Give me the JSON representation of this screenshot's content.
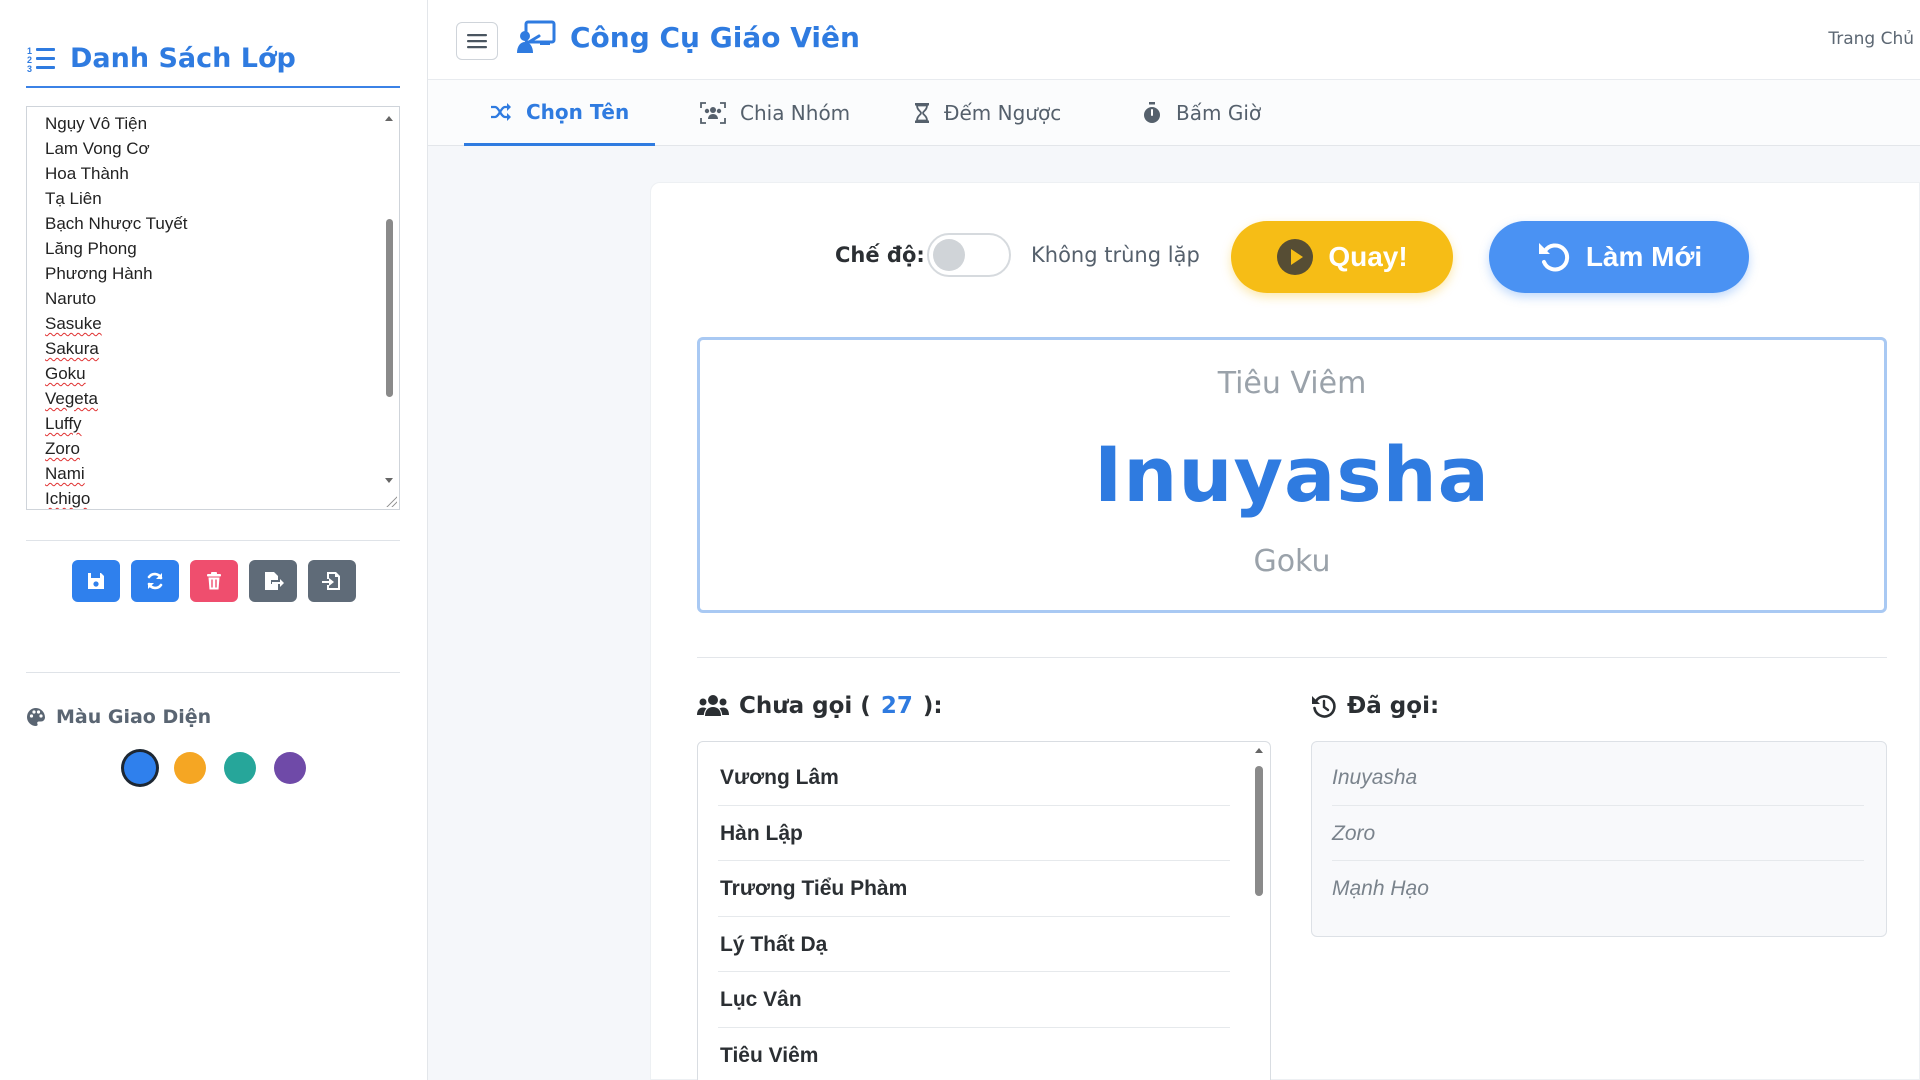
{
  "sidebar": {
    "title": "Danh Sách Lớp",
    "names": [
      "Ngụy Vô Tiện",
      "Lam Vong Cơ",
      "Hoa Thành",
      "Tạ Liên",
      "Bạch Nhược Tuyết",
      "Lăng Phong",
      "Phương Hành",
      "Naruto",
      "Sasuke",
      "Sakura",
      "Goku",
      "Vegeta",
      "Luffy",
      "Zoro",
      "Nami",
      "Ichigo"
    ],
    "tool_icons": [
      "save-icon",
      "refresh-icon",
      "trash-icon",
      "export-icon",
      "import-icon"
    ],
    "theme_title": "Màu Giao Diện",
    "theme_colors": [
      "#2f80ed",
      "#f5a623",
      "#26a69a",
      "#6f4aa8"
    ]
  },
  "header": {
    "app_title": "Công Cụ Giáo Viên",
    "home_link": "Trang Chủ"
  },
  "tabs": [
    {
      "label": "Chọn Tên",
      "icon": "shuffle-icon"
    },
    {
      "label": "Chia Nhóm",
      "icon": "group-icon"
    },
    {
      "label": "Đếm Ngược",
      "icon": "hourglass-icon"
    },
    {
      "label": "Bấm Giờ",
      "icon": "stopwatch-icon"
    }
  ],
  "picker": {
    "mode_label": "Chế độ:",
    "toggle_label": "Không trùng lặp",
    "toggle_on": false,
    "spin_label": "Quay!",
    "reset_label": "Làm Mới",
    "prev_name": "Tiêu Viêm",
    "current_name": "Inuyasha",
    "next_name": "Goku"
  },
  "pending": {
    "label_prefix": "Chưa gọi (",
    "count": "27",
    "label_suffix": "):",
    "names": [
      "Vương Lâm",
      "Hàn Lập",
      "Trương Tiểu Phàm",
      "Lý Thất Dạ",
      "Lục Vân",
      "Tiêu Viêm"
    ]
  },
  "called": {
    "label": "Đã gọi:",
    "names": [
      "Inuyasha",
      "Zoro",
      "Mạnh Hạo"
    ]
  },
  "colors": {
    "accent": "#2f7be0",
    "spin_button": "#f6bd16",
    "reset_button": "#4a92f3",
    "delete_button": "#ef4e6e"
  }
}
